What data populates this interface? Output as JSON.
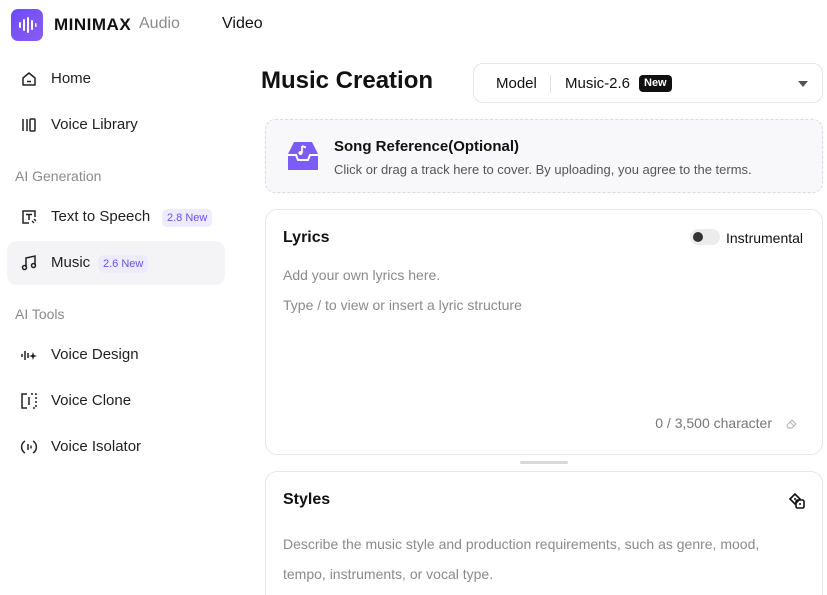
{
  "brand": {
    "name": "MINIMAX",
    "accent": "#6c4ff0"
  },
  "top_nav": {
    "audio": "Audio",
    "video": "Video"
  },
  "sidebar": {
    "items": [
      {
        "label": "Home",
        "icon": "home-icon"
      },
      {
        "label": "Voice Library",
        "icon": "library-icon"
      }
    ],
    "section_generation": "AI Generation",
    "generation_items": [
      {
        "label": "Text to Speech",
        "badge": "2.8 New",
        "icon": "text-to-speech-icon"
      },
      {
        "label": "Music",
        "badge": "2.6 New",
        "icon": "music-note-icon",
        "active": true
      }
    ],
    "section_tools": "AI Tools",
    "tool_items": [
      {
        "label": "Voice Design",
        "icon": "voice-design-icon"
      },
      {
        "label": "Voice Clone",
        "icon": "voice-clone-icon"
      },
      {
        "label": "Voice Isolator",
        "icon": "voice-isolator-icon"
      }
    ]
  },
  "main": {
    "title": "Music Creation",
    "model": {
      "label": "Model",
      "value": "Music-2.6",
      "badge": "New"
    },
    "song_reference": {
      "title": "Song Reference(Optional)",
      "subtitle": "Click or drag a track here to cover. By uploading, you agree to the terms."
    },
    "lyrics": {
      "title": "Lyrics",
      "instrumental_label": "Instrumental",
      "instrumental_on": false,
      "placeholder_1": "Add your own lyrics here.",
      "placeholder_2": "Type / to view or insert a lyric structure",
      "char_count": "0 / 3,500 character"
    },
    "styles": {
      "title": "Styles",
      "placeholder": "Describe the music style and production requirements, such as genre, mood, tempo, instruments, or vocal type."
    }
  }
}
